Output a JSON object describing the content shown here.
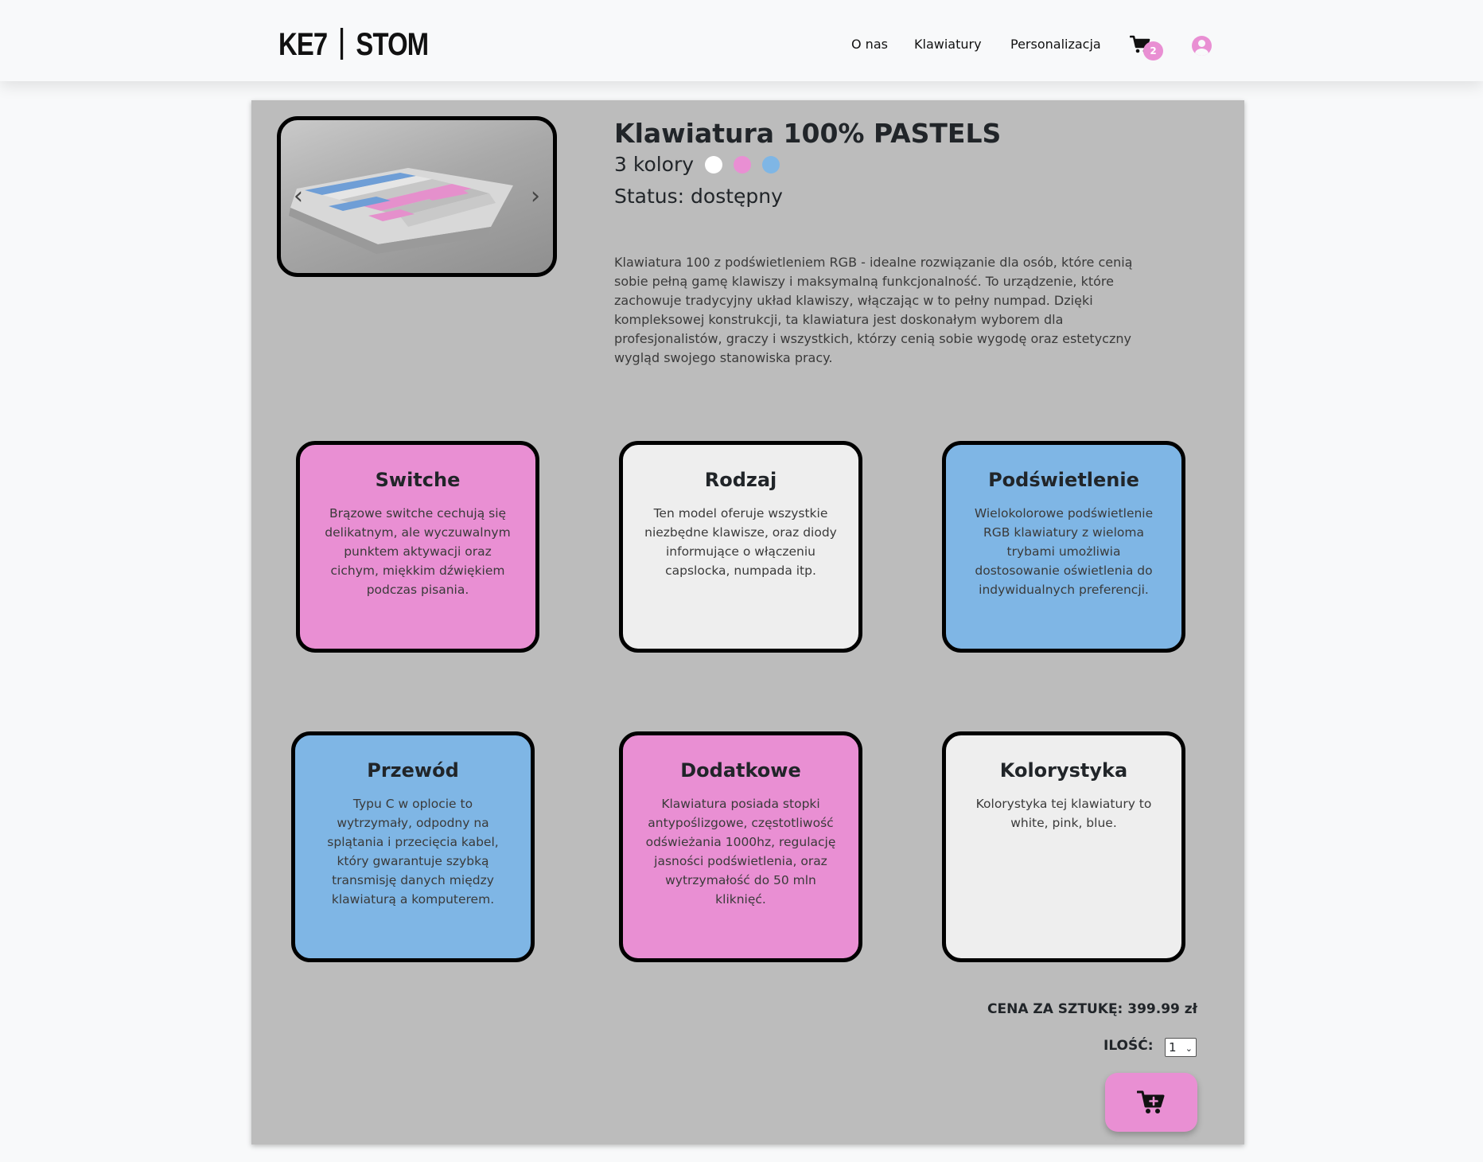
{
  "brand": {
    "logo_left": "KE7",
    "logo_right": "STOM"
  },
  "nav": {
    "items": [
      {
        "label": "O nas"
      },
      {
        "label": "Klawiatury"
      },
      {
        "label": "Personalizacja"
      }
    ],
    "cart_count": "2",
    "cart_icon": "cart-icon",
    "user_icon": "user-circle-icon"
  },
  "product": {
    "title": "Klawiatura 100% PASTELS",
    "colors_label": "3 kolory",
    "colors": [
      "#ffffff",
      "#e98fd3",
      "#7fb6e5"
    ],
    "status": "Status: dostępny",
    "description": "Klawiatura 100 z podświetleniem RGB - idealne rozwiązanie dla osób, które cenią sobie pełną gamę klawiszy i maksymalną funkcjonalność. To urządzenie, które zachowuje tradycyjny układ klawiszy, włączając w to pełny numpad. Dzięki kompleksowej konstrukcji, ta klawiatura jest doskonałym wyborem dla profesjonalistów, graczy i wszystkich, którzy cenią sobie wygodę oraz estetyczny wygląd swojego stanowiska pracy.",
    "carousel_prev": "‹",
    "carousel_next": "›"
  },
  "features": [
    {
      "title": "Switche",
      "text": "Brązowe switche cechują się delikatnym, ale wyczuwalnym punktem aktywacji oraz cichym, miękkim dźwiękiem podczas pisania.",
      "color": "#e98fd3"
    },
    {
      "title": "Rodzaj",
      "text": "Ten model oferuje wszystkie niezbędne klawisze, oraz diody informujące o włączeniu capslocka, numpada itp.",
      "color": "#eeeeee"
    },
    {
      "title": "Podświetlenie",
      "text": "Wielokolorowe podświetlenie RGB klawiatury z wieloma trybami umożliwia dostosowanie oświetlenia do indywidualnych preferencji.",
      "color": "#7fb6e5"
    },
    {
      "title": "Przewód",
      "text": "Typu C w oplocie to wytrzymały, odpodny na splątania i przecięcia kabel, który gwarantuje szybką transmisję danych między klawiaturą a komputerem.",
      "color": "#7fb6e5"
    },
    {
      "title": "Dodatkowe",
      "text": "Klawiatura posiada stopki antypoślizgowe, częstotliwość odświeżania 1000hz, regulację jasności podświetlenia, oraz wytrzymałość do 50 mln kliknięć.",
      "color": "#e98fd3"
    },
    {
      "title": "Kolorystyka",
      "text": "Kolorystyka tej klawiatury to white, pink, blue.",
      "color": "#eeeeee"
    }
  ],
  "purchase": {
    "price": "CENA ZA SZTUKĘ: 399.99 zł",
    "qty_label": "ILOŚĆ:",
    "qty_value": "1",
    "add_icon": "cart-plus-icon"
  }
}
